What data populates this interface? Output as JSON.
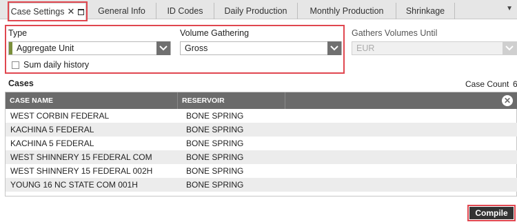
{
  "tabs": [
    {
      "label": "Case Settings",
      "active": true
    },
    {
      "label": "General Info"
    },
    {
      "label": "ID Codes"
    },
    {
      "label": "Daily Production"
    },
    {
      "label": "Monthly Production"
    },
    {
      "label": "Shrinkage"
    }
  ],
  "settings": {
    "type_label": "Type",
    "type_value": "Aggregate Unit",
    "volume_label": "Volume Gathering",
    "volume_value": "Gross",
    "gathers_label": "Gathers Volumes Until",
    "gathers_value": "EUR",
    "sum_daily_label": "Sum daily history",
    "sum_daily_checked": false
  },
  "cases": {
    "title": "Cases",
    "count_label": "Case Count",
    "count_value": "6",
    "columns": [
      "CASE NAME",
      "RESERVOIR"
    ],
    "rows": [
      {
        "name": "WEST CORBIN FEDERAL",
        "reservoir": "BONE SPRING"
      },
      {
        "name": "KACHINA 5 FEDERAL",
        "reservoir": "BONE SPRING"
      },
      {
        "name": "KACHINA 5 FEDERAL",
        "reservoir": "BONE SPRING"
      },
      {
        "name": "WEST SHINNERY 15 FEDERAL COM",
        "reservoir": "BONE SPRING"
      },
      {
        "name": "WEST SHINNERY 15 FEDERAL 002H",
        "reservoir": "BONE SPRING"
      },
      {
        "name": "YOUNG 16 NC STATE COM 001H",
        "reservoir": "BONE SPRING"
      }
    ]
  },
  "compile_label": "Compile",
  "colors": {
    "highlight": "#e0464f",
    "header_bg": "#6b6b6b",
    "accent": "#7a8f3b"
  }
}
